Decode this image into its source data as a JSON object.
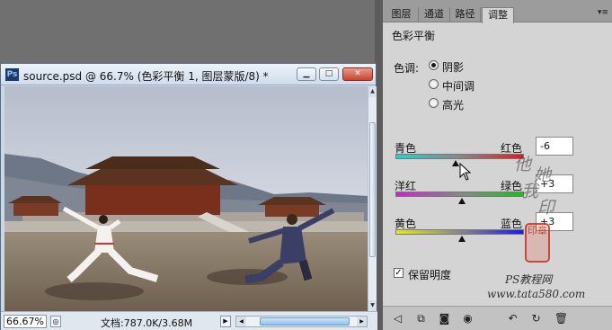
{
  "document": {
    "app_icon": "Ps",
    "title": "source.psd @ 66.7% (色彩平衡 1, 图层蒙版/8) *",
    "zoom": "66.67%",
    "doc_size": "文档:787.0K/3.68M"
  },
  "panel": {
    "tabs": [
      "图层",
      "通道",
      "路径",
      "调整"
    ],
    "active_tab": "调整",
    "menu_glyph": "▾≡",
    "title": "色彩平衡",
    "tone_label": "色调:",
    "tones": [
      "阴影",
      "中间调",
      "高光"
    ],
    "selected_tone": "阴影",
    "sliders": [
      {
        "left": "青色",
        "right": "红色",
        "value": "-6",
        "number": -6,
        "left_color": "#22d3d3",
        "right_color": "#e51b1b"
      },
      {
        "left": "洋红",
        "right": "绿色",
        "value": "+3",
        "number": 3,
        "left_color": "#d21fd2",
        "right_color": "#18c418"
      },
      {
        "left": "黄色",
        "right": "蓝色",
        "value": "+3",
        "number": 3,
        "left_color": "#e8e81a",
        "right_color": "#1a1ae8"
      }
    ],
    "preserve_luminosity": "保留明度",
    "preserve_checked": true
  },
  "watermark": {
    "calligraphy": [
      "他",
      "她",
      "我",
      "印"
    ],
    "seal": "印章",
    "caption": "PS教程网",
    "url": "www.tata580.com"
  },
  "colors": {
    "sky_top": "#b9c1cf",
    "ground": "#8a7a66",
    "roof": "#5a3420"
  }
}
